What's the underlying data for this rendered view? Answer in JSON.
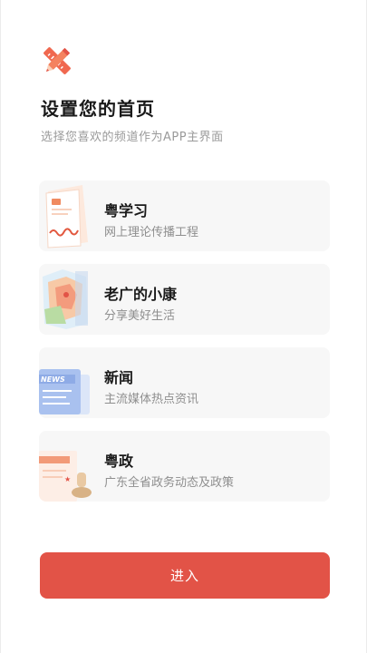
{
  "header": {
    "logo_icon": "pencil-ruler-icon",
    "title": "设置您的首页",
    "subtitle": "选择您喜欢的频道作为APP主界面"
  },
  "channels": [
    {
      "name": "粤学习",
      "desc": "网上理论传播工程",
      "icon": "book-illustration-icon"
    },
    {
      "name": "老广的小康",
      "desc": "分享美好生活",
      "icon": "map-illustration-icon"
    },
    {
      "name": "新闻",
      "desc": "主流媒体热点资讯",
      "icon": "newspaper-illustration-icon"
    },
    {
      "name": "粤政",
      "desc": "广东全省政务动态及政策",
      "icon": "document-seal-illustration-icon"
    }
  ],
  "enter_button": {
    "label": "进入"
  },
  "colors": {
    "accent": "#e25347",
    "card_bg": "#f7f7f7"
  }
}
